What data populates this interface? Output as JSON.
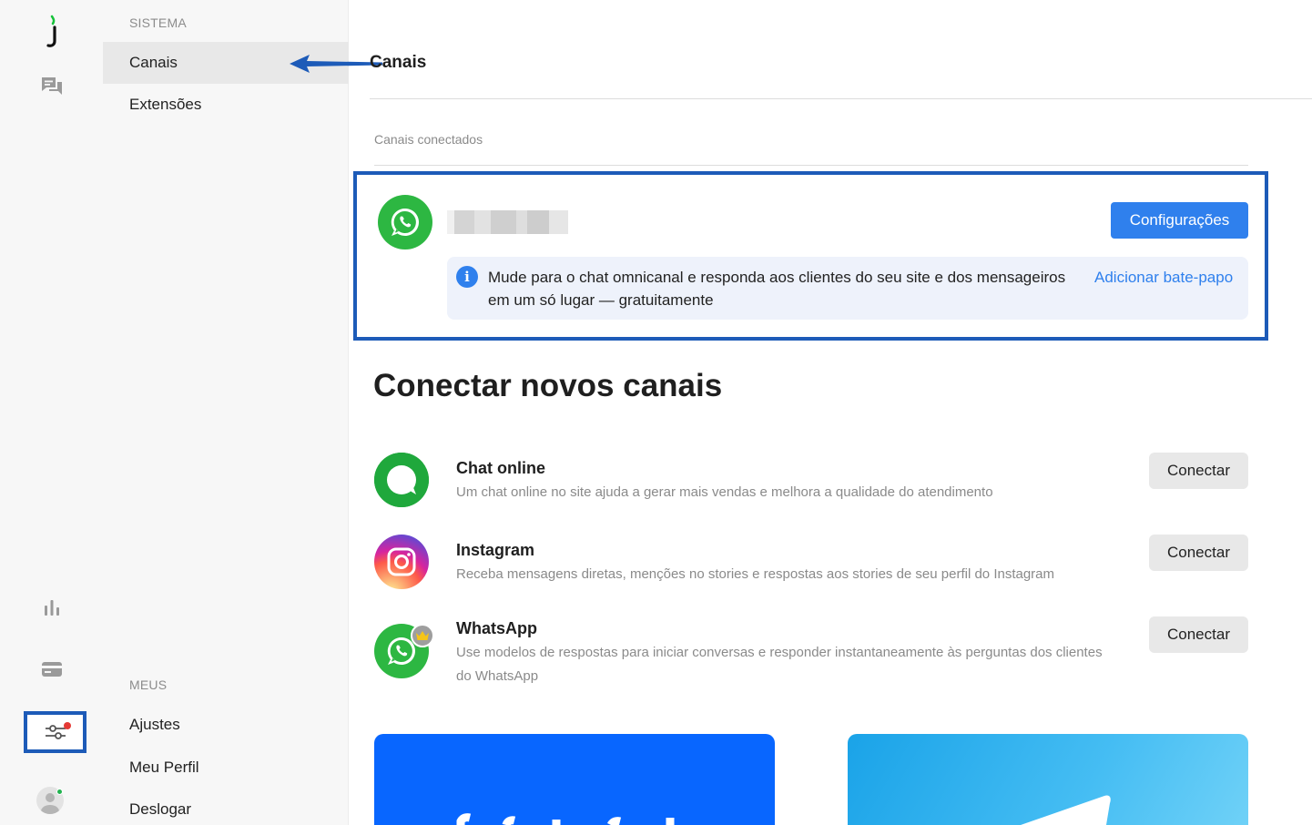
{
  "sidebar": {
    "section_system": "SISTEMA",
    "items_system": [
      {
        "label": "Canais",
        "active": true
      },
      {
        "label": "Extensões",
        "active": false
      }
    ],
    "section_mine": "MEUS",
    "items_mine": [
      {
        "label": "Ajustes"
      },
      {
        "label": "Meu Perfil"
      },
      {
        "label": "Deslogar"
      }
    ]
  },
  "rail": {
    "icons": [
      "jivo-logo-icon",
      "chats-icon",
      "reports-icon",
      "billing-icon",
      "settings-icon",
      "user-avatar-icon"
    ]
  },
  "main": {
    "title": "Canais",
    "connected_label": "Canais conectados",
    "connected_channel": {
      "type": "WhatsApp",
      "config_button": "Configurações",
      "info_text": "Mude para o chat omnicanal e responda aos clientes do seu site e dos mensageiros em um só lugar — gratuitamente",
      "info_link": "Adicionar bate-papo"
    },
    "new_channels_heading": "Conectar novos canais",
    "channels": [
      {
        "name": "Chat online",
        "description": "Um chat online no site ajuda a gerar mais vendas e melhora a qualidade do atendimento",
        "button": "Conectar"
      },
      {
        "name": "Instagram",
        "description": "Receba mensagens diretas, menções no stories e respostas aos stories de seu perfil do Instagram",
        "button": "Conectar"
      },
      {
        "name": "WhatsApp",
        "description": "Use modelos de respostas para iniciar conversas e responder instantaneamente às perguntas dos clientes do WhatsApp",
        "button": "Conectar"
      }
    ]
  },
  "colors": {
    "accent": "#2f80ed",
    "highlight_border": "#1d5bb8",
    "whatsapp": "#2db742",
    "facebook": "#0866ff",
    "telegram": "#29a9eb"
  }
}
